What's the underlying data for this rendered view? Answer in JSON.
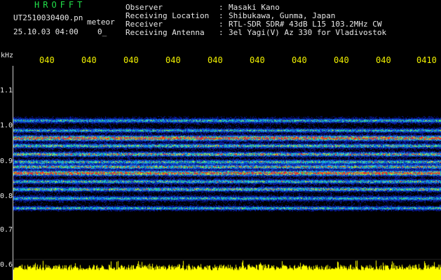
{
  "header": {
    "brand": "HROFFT",
    "file_name": "UT2510030400.pn",
    "detector": "meteor",
    "datetime": "25.10.03 04:00",
    "counter": "0_",
    "info": [
      {
        "label": "Observer",
        "value": "Masaki Kano"
      },
      {
        "label": "Receiving Location",
        "value": "Shibukawa, Gunma, Japan"
      },
      {
        "label": "Receiver",
        "value": "RTL-SDR SDR# 43dB L15 103.2MHz CW"
      },
      {
        "label": "Receiving Antenna",
        "value": "3el Yagi(V) Az 330 for Vladivostok"
      }
    ]
  },
  "axes": {
    "y_unit": "kHz",
    "y_ticks": [
      "1.1",
      "1.0",
      "0.9",
      "0.8",
      "0.7",
      "0.6"
    ],
    "x_ticks": [
      "040",
      "040",
      "040",
      "040",
      "040",
      "040",
      "040",
      "040",
      "040",
      "0410"
    ]
  },
  "colors": {
    "background": "#000000",
    "title": "#22e04a",
    "time_labels": "#f0f000",
    "text": "#e8e8e8",
    "noise_floor": "#ffff00"
  }
}
